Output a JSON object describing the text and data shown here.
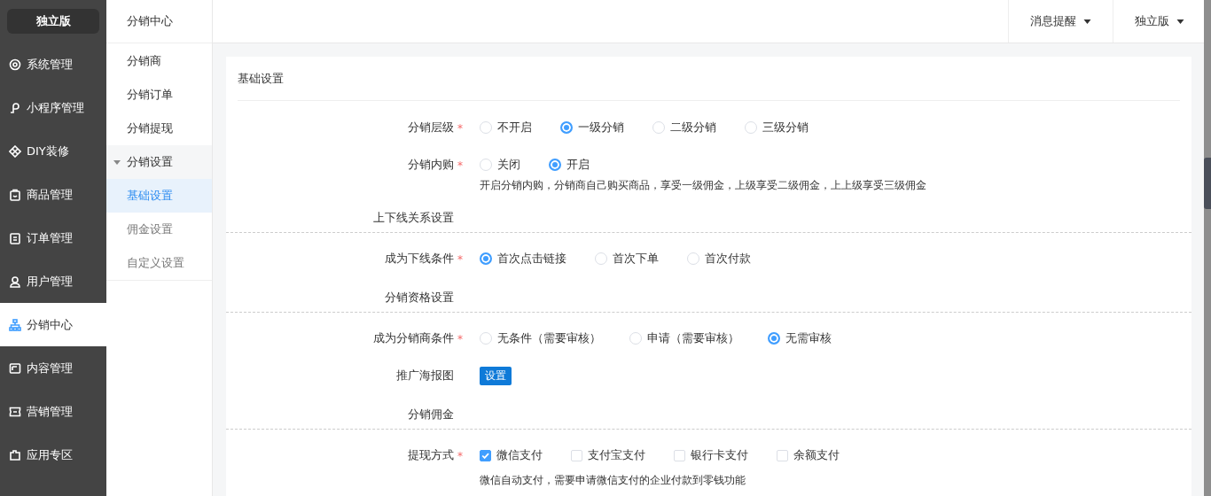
{
  "sidebar": {
    "brand": "独立版",
    "items": [
      {
        "label": "系统管理",
        "selected": false
      },
      {
        "label": "小程序管理",
        "selected": false
      },
      {
        "label": "DIY装修",
        "selected": false
      },
      {
        "label": "商品管理",
        "selected": false
      },
      {
        "label": "订单管理",
        "selected": false
      },
      {
        "label": "用户管理",
        "selected": false
      },
      {
        "label": "分销中心",
        "selected": true
      },
      {
        "label": "内容管理",
        "selected": false
      },
      {
        "label": "营销管理",
        "selected": false
      },
      {
        "label": "应用专区",
        "selected": false
      }
    ]
  },
  "subnav": {
    "title": "分销中心",
    "items": [
      {
        "label": "分销商",
        "selected": false
      },
      {
        "label": "分销订单",
        "selected": false
      },
      {
        "label": "分销提现",
        "selected": false
      },
      {
        "label": "分销设置",
        "selected": false,
        "expanded": true,
        "children": [
          {
            "label": "基础设置",
            "selected": true
          },
          {
            "label": "佣金设置",
            "selected": false
          },
          {
            "label": "自定义设置",
            "selected": false
          }
        ]
      }
    ]
  },
  "topbar": {
    "menus": [
      {
        "label": "消息提醒"
      },
      {
        "label": "独立版"
      }
    ]
  },
  "card": {
    "title": "基础设置",
    "rows": [
      {
        "kind": "radio",
        "label": "分销层级",
        "required_mark": "*",
        "options": [
          {
            "label": "不开启",
            "selected": false
          },
          {
            "label": "一级分销",
            "selected": true
          },
          {
            "label": "二级分销",
            "selected": false
          },
          {
            "label": "三级分销",
            "selected": false
          }
        ]
      },
      {
        "kind": "radio",
        "label": "分销内购",
        "required_mark": "*",
        "options": [
          {
            "label": "关闭",
            "selected": false
          },
          {
            "label": "开启",
            "selected": true
          }
        ],
        "help": "开启分销内购，分销商自己购买商品，享受一级佣金，上级享受二级佣金，上上级享受三级佣金"
      },
      {
        "kind": "section",
        "label": "上下线关系设置"
      },
      {
        "kind": "radio",
        "label": "成为下线条件",
        "required_mark": "*",
        "options": [
          {
            "label": "首次点击链接",
            "selected": true
          },
          {
            "label": "首次下单",
            "selected": false
          },
          {
            "label": "首次付款",
            "selected": false
          }
        ]
      },
      {
        "kind": "section",
        "label": "分销资格设置"
      },
      {
        "kind": "radio",
        "label": "成为分销商条件",
        "required_mark": "*",
        "options": [
          {
            "label": "无条件（需要审核）",
            "selected": false
          },
          {
            "label": "申请（需要审核）",
            "selected": false
          },
          {
            "label": "无需审核",
            "selected": true
          }
        ]
      },
      {
        "kind": "button",
        "label": "推广海报图",
        "button": "设置"
      },
      {
        "kind": "section",
        "label": "分销佣金"
      },
      {
        "kind": "checkbox",
        "label": "提现方式",
        "required_mark": "*",
        "options": [
          {
            "label": "微信支付",
            "checked": true
          },
          {
            "label": "支付宝支付",
            "checked": false
          },
          {
            "label": "银行卡支付",
            "checked": false
          },
          {
            "label": "余额支付",
            "checked": false
          }
        ],
        "help": "微信自动支付，需要申请微信支付的企业付款到零钱功能"
      }
    ]
  }
}
